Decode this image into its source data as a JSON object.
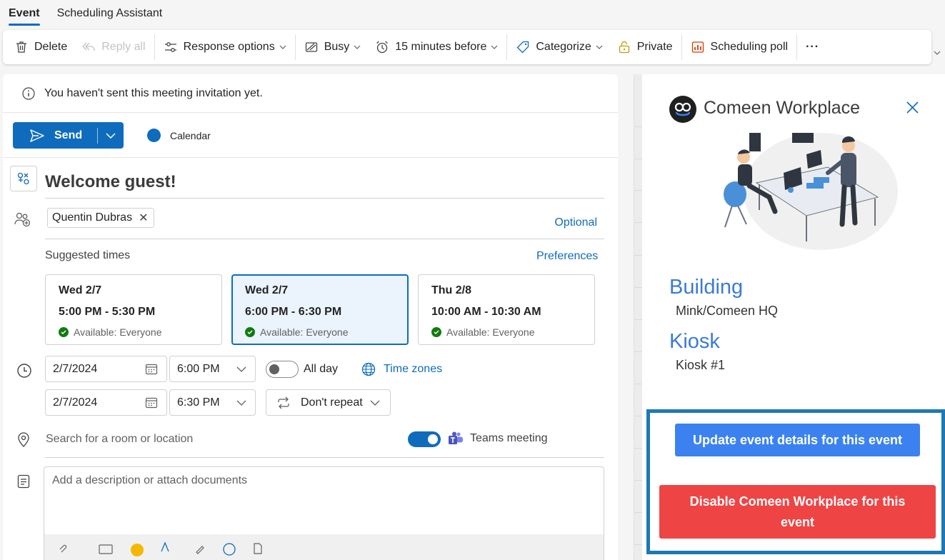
{
  "tabs": [
    {
      "label": "Event",
      "active": true
    },
    {
      "label": "Scheduling Assistant",
      "active": false
    }
  ],
  "ribbon": {
    "delete": "Delete",
    "reply_all": "Reply all",
    "response_options": "Response options",
    "busy": "Busy",
    "reminder": "15 minutes before",
    "categorize": "Categorize",
    "private": "Private",
    "scheduling_poll": "Scheduling poll",
    "more": "···"
  },
  "info_bar": {
    "text": "You haven't sent this meeting invitation yet."
  },
  "send": {
    "label": "Send"
  },
  "calendar": {
    "label": "Calendar",
    "color": "#0f6cbd"
  },
  "event": {
    "title": "Welcome guest!"
  },
  "attendees": {
    "items": [
      {
        "name": "Quentin Dubras"
      }
    ],
    "optional_label": "Optional"
  },
  "suggested": {
    "label": "Suggested times",
    "preferences_label": "Preferences",
    "slots": [
      {
        "date": "Wed 2/7",
        "time": "5:00 PM - 5:30 PM",
        "availability": "Available: Everyone",
        "selected": false
      },
      {
        "date": "Wed 2/7",
        "time": "6:00 PM - 6:30 PM",
        "availability": "Available: Everyone",
        "selected": true
      },
      {
        "date": "Thu 2/8",
        "time": "10:00 AM - 10:30 AM",
        "availability": "Available: Everyone",
        "selected": false
      }
    ]
  },
  "datetime": {
    "start_date": "2/7/2024",
    "start_time": "6:00 PM",
    "end_date": "2/7/2024",
    "end_time": "6:30 PM",
    "all_day_label": "All day",
    "time_zones_label": "Time zones",
    "repeat_label": "Don't repeat"
  },
  "location": {
    "placeholder": "Search for a room or location",
    "teams_label": "Teams meeting"
  },
  "description": {
    "placeholder": "Add a description or attach documents"
  },
  "panel": {
    "title": "Comeen Workplace",
    "building_heading": "Building",
    "building_value": "Mink/Comeen HQ",
    "kiosk_heading": "Kiosk",
    "kiosk_value": "Kiosk #1",
    "update_button": "Update event details for this event",
    "disable_button": "Disable Comeen Workplace for this event"
  },
  "colors": {
    "accent": "#0f6cbd",
    "panel_blue": "#3b82f0",
    "panel_red": "#ef4444",
    "panel_heading": "#3a7bd5"
  }
}
